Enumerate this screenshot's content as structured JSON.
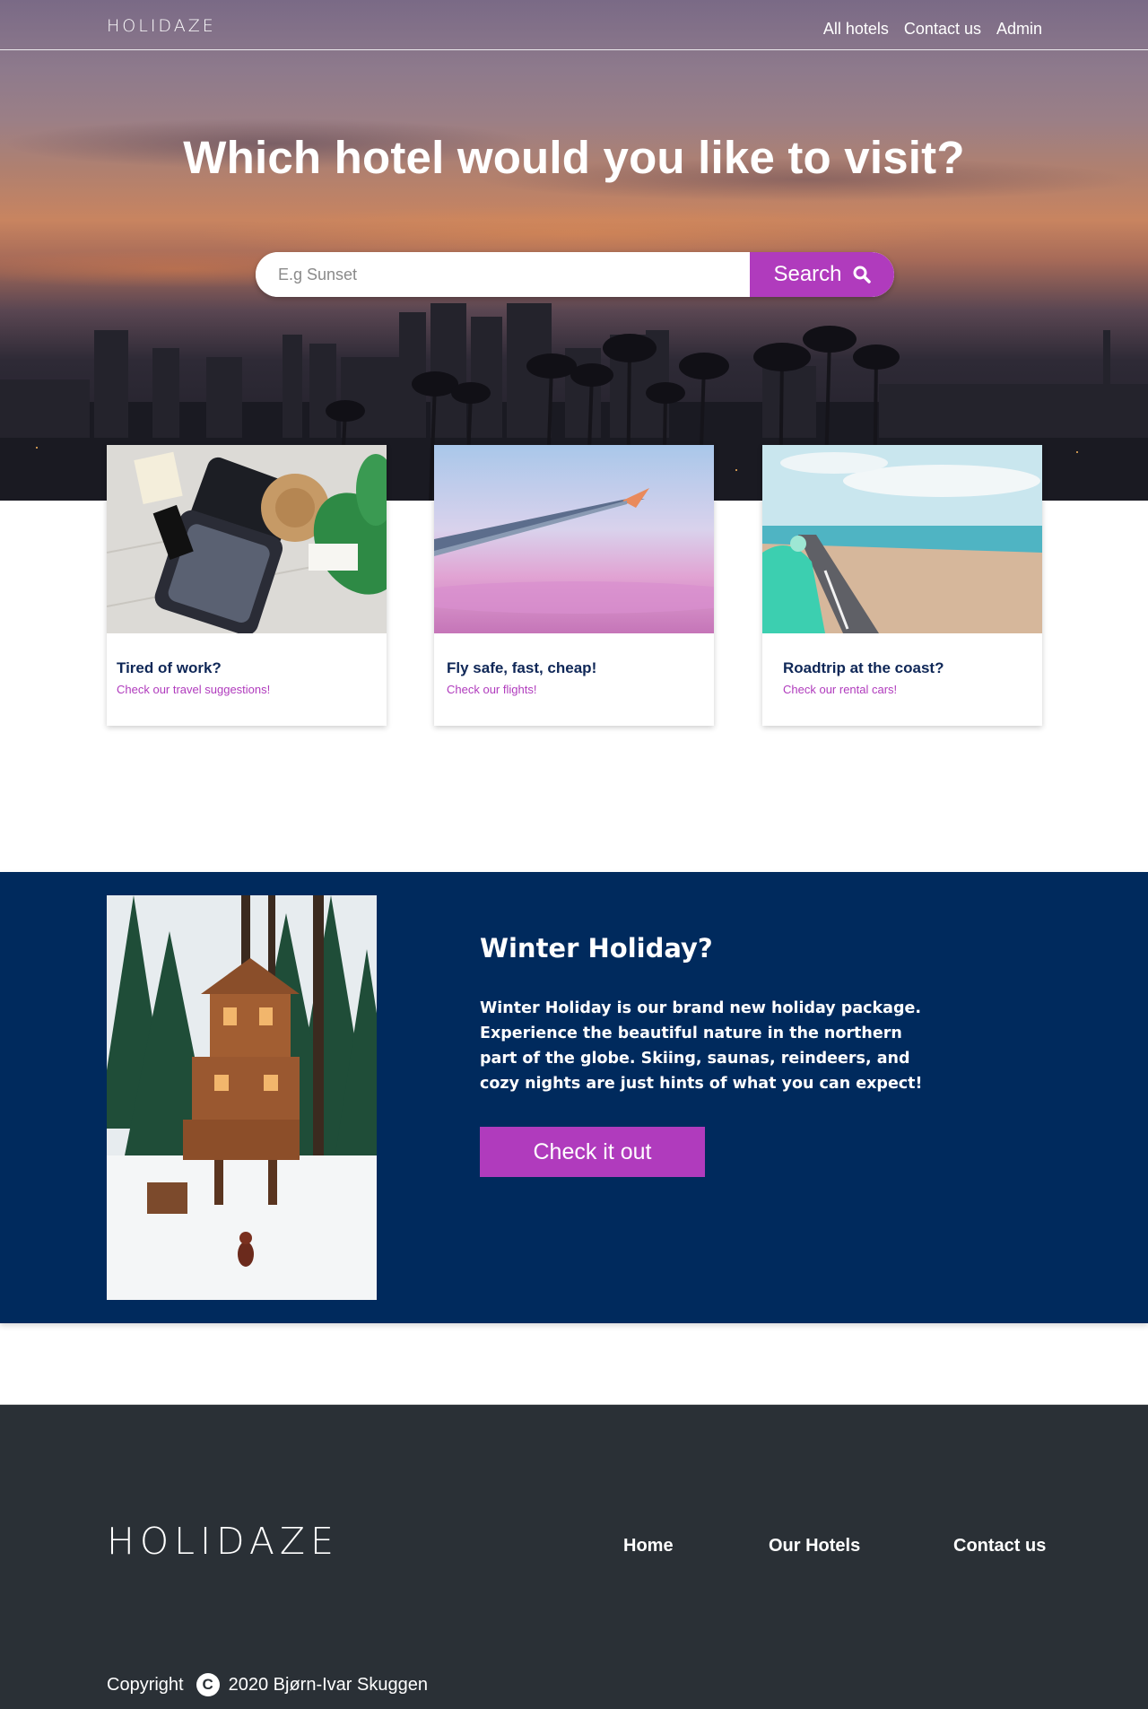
{
  "header": {
    "logo": "HOLIDAZE",
    "nav": [
      {
        "label": "All hotels"
      },
      {
        "label": "Contact us"
      },
      {
        "label": "Admin"
      }
    ]
  },
  "hero": {
    "title": "Which hotel would you like to visit?",
    "search": {
      "placeholder": "E.g Sunset",
      "value": "",
      "button_label": "Search",
      "button_icon": "search-icon"
    }
  },
  "cards": [
    {
      "title": "Tired of work?",
      "subtitle": "Check our travel suggestions!",
      "image": "suitcase-photo"
    },
    {
      "title": "Fly safe, fast, cheap!",
      "subtitle": "Check our flights!",
      "image": "airplane-wing-photo"
    },
    {
      "title": "Roadtrip at the coast?",
      "subtitle": "Check our rental cars!",
      "image": "coastal-road-photo"
    }
  ],
  "promo": {
    "title": "Winter Holiday?",
    "text": "Winter Holiday is our brand new holiday package. Experience the beautiful nature in the northern part of the globe. Skiing, saunas, reindeers, and cozy nights are just hints of what you can expect!",
    "button_label": "Check it out",
    "image": "treehouse-snow-photo"
  },
  "footer": {
    "logo": "HOLIDAZE",
    "links": [
      {
        "label": "Home"
      },
      {
        "label": "Our Hotels"
      },
      {
        "label": "Contact us"
      }
    ],
    "copyright_label": "Copyright",
    "copyright_icon": "copyright-icon",
    "copyright_text": "2020 Bjørn-Ivar Skuggen"
  },
  "colors": {
    "accent": "#b03bbd",
    "navy": "#002a5d",
    "card_title": "#0f2757",
    "footer_bg": "#2a3036"
  }
}
